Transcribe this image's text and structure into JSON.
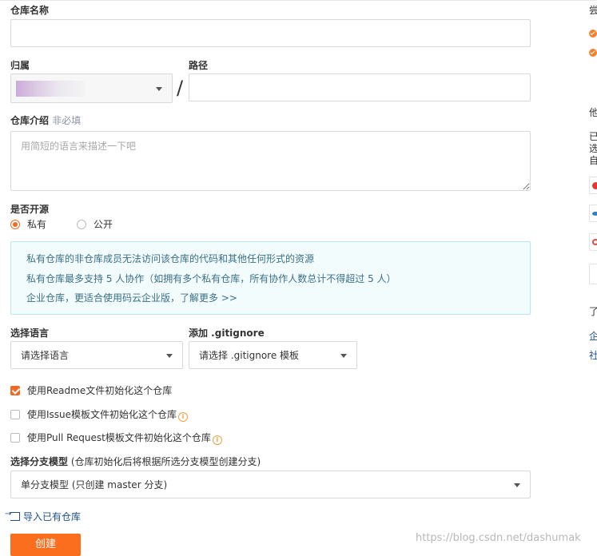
{
  "form": {
    "repo_name_label": "仓库名称",
    "repo_name_value": "",
    "owner_label": "归属",
    "owner_value": "",
    "path_label": "路径",
    "path_separator": "/",
    "path_value": "",
    "desc_label": "仓库介绍",
    "desc_optional": "非必填",
    "desc_placeholder": "用简短的语言来描述一下吧",
    "open_source_label": "是否开源",
    "private_label": "私有",
    "public_label": "公开",
    "notice_lines": [
      "私有仓库的非仓库成员无法访问该仓库的代码和其他任何形式的资源",
      "私有仓库最多支持 5 人协作（如拥有多个私有仓库，所有协作人数总计不得超过 5 人）",
      "企业仓库，更适合使用码云企业版，了解更多 >>"
    ],
    "language_label": "选择语言",
    "language_value": "请选择语言",
    "gitignore_label": "添加 .gitignore",
    "gitignore_value": "请选择 .gitignore 模板",
    "init_readme_label": "使用Readme文件初始化这个仓库",
    "init_issue_label": "使用Issue模板文件初始化这个仓库",
    "init_pr_label": "使用Pull Request模板文件初始化这个仓库",
    "branch_model_label": "选择分支模型",
    "branch_model_hint": "(仓库初始化后将根据所选分支模型创建分支)",
    "branch_model_value": "单分支模型 (只创建 master 分支)",
    "import_label": "导入已有仓库",
    "create_button": "创建"
  },
  "right_column": {
    "frag_1": "尝",
    "frag_2": "他",
    "frag_3": "已",
    "frag_4": "选",
    "frag_5": "自",
    "frag_6": "了",
    "frag_7": "企",
    "frag_8": "社"
  },
  "watermark": "https://blog.csdn.net/dashumak",
  "colors": {
    "accent": "#fa6e1e",
    "notice_bg": "#f2fcfd",
    "notice_border": "#b9e5ec",
    "notice_text": "#3a6f86"
  }
}
